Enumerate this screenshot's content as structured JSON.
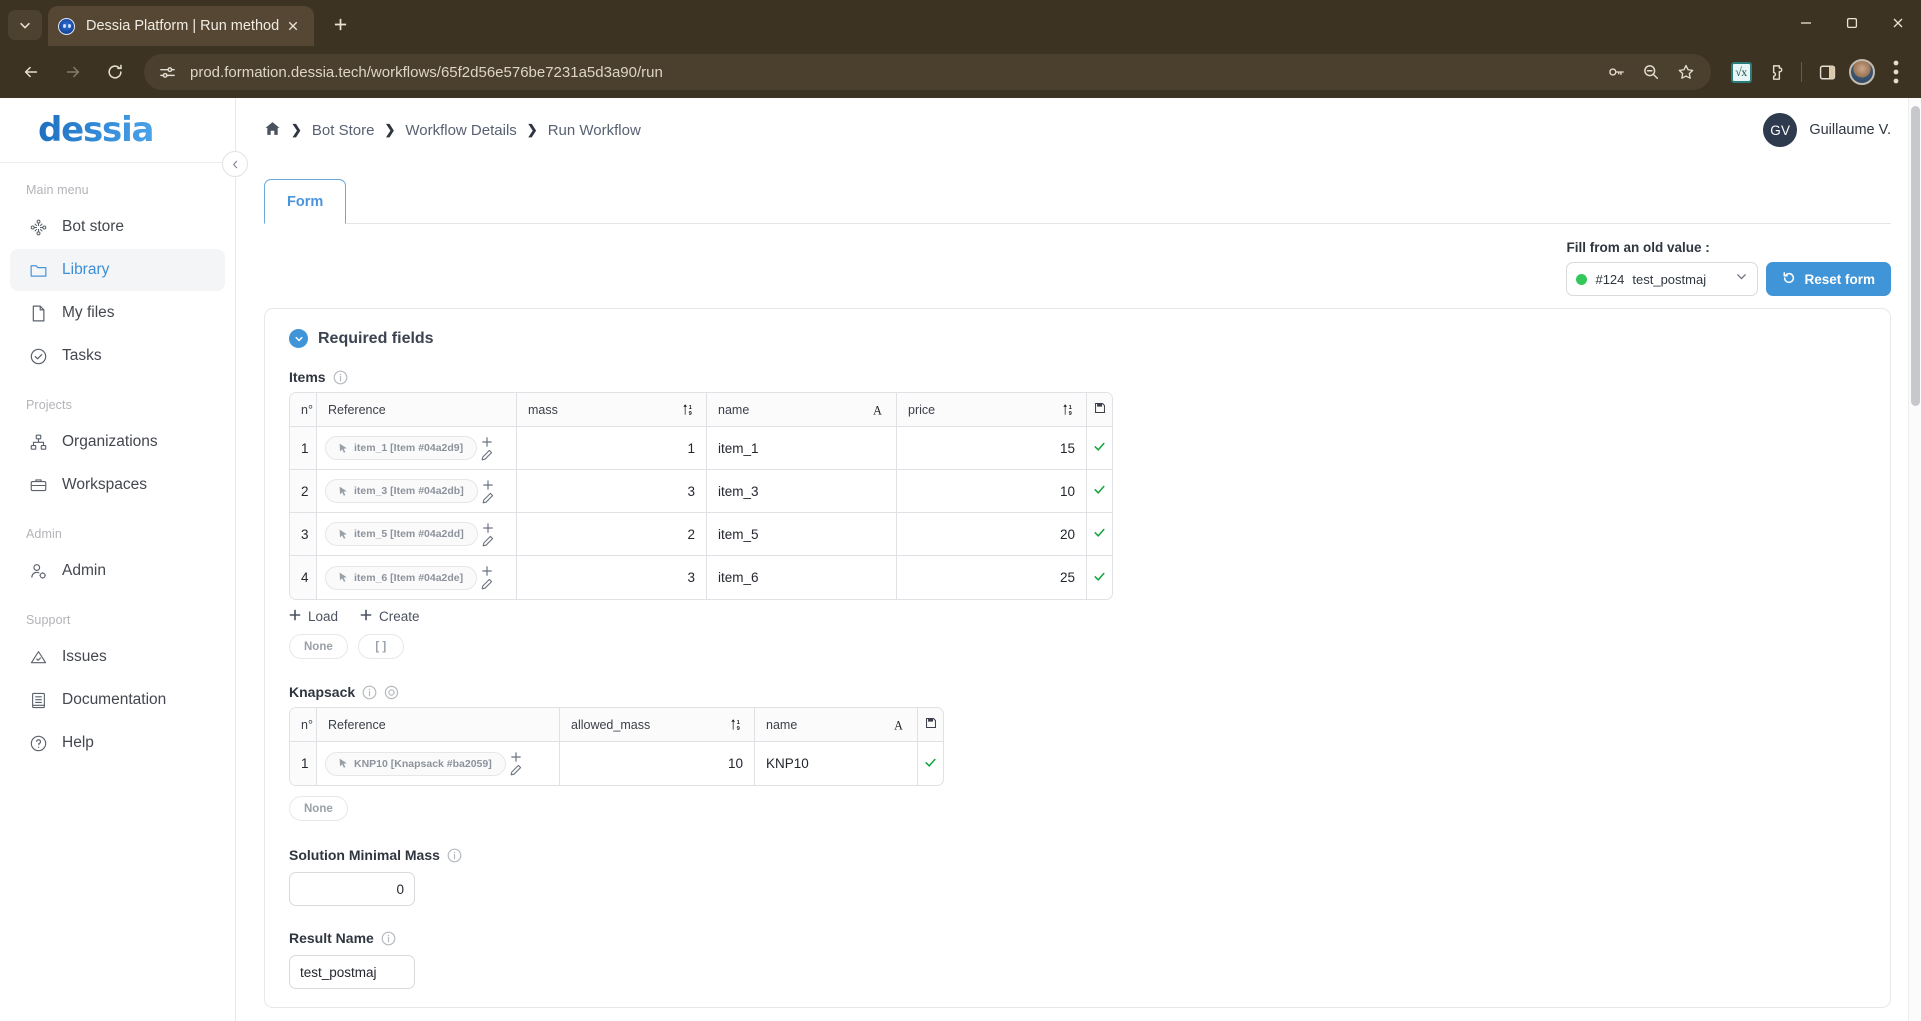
{
  "browser": {
    "tab": {
      "title": "Dessia Platform | Run method",
      "favicon": "dessia-favicon"
    },
    "new_tab_label": "+",
    "url": "prod.formation.dessia.tech/workflows/65f2d56e576be7231a5d3a90/run",
    "toolbar_icons": [
      "back-arrow-icon",
      "forward-arrow-icon",
      "reload-icon",
      "site-settings-icon",
      "password-key-icon",
      "zoom-out-icon",
      "bookmark-star-icon",
      "math-extension-icon",
      "extensions-puzzle-icon",
      "side-panel-icon",
      "profile-avatar-icon",
      "three-dot-menu-icon"
    ],
    "window_controls": [
      "minimize",
      "maximize",
      "close"
    ]
  },
  "sidebar": {
    "logo": "dessia",
    "sections": [
      {
        "title": "Main menu",
        "items": [
          {
            "label": "Bot store",
            "icon": "bot-store-icon",
            "active": false
          },
          {
            "label": "Library",
            "icon": "folder-icon",
            "active": true
          },
          {
            "label": "My files",
            "icon": "file-icon",
            "active": false
          },
          {
            "label": "Tasks",
            "icon": "check-circle-icon",
            "active": false
          }
        ]
      },
      {
        "title": "Projects",
        "items": [
          {
            "label": "Organizations",
            "icon": "org-chart-icon",
            "active": false
          },
          {
            "label": "Workspaces",
            "icon": "briefcase-icon",
            "active": false
          }
        ]
      },
      {
        "title": "Admin",
        "items": [
          {
            "label": "Admin",
            "icon": "user-gear-icon",
            "active": false
          }
        ]
      },
      {
        "title": "Support",
        "items": [
          {
            "label": "Issues",
            "icon": "warning-triangle-icon",
            "active": false
          },
          {
            "label": "Documentation",
            "icon": "book-icon",
            "active": false
          },
          {
            "label": "Help",
            "icon": "question-circle-icon",
            "active": false
          }
        ]
      }
    ]
  },
  "topbar": {
    "breadcrumb": [
      "Bot Store",
      "Workflow Details",
      "Run Workflow"
    ],
    "separator": "›",
    "user": {
      "initials": "GV",
      "name": "Guillaume V."
    }
  },
  "tabs": [
    {
      "label": "Form",
      "active": true
    }
  ],
  "old_value": {
    "label": "Fill from an old value :",
    "status_color": "#34c759",
    "id": "#124",
    "name": "test_postmaj",
    "reset_label": "Reset form"
  },
  "form": {
    "section_title": "Required fields",
    "items": {
      "label": "Items",
      "columns": [
        {
          "key": "num",
          "label": "n°",
          "icon": ""
        },
        {
          "key": "ref",
          "label": "Reference",
          "icon": ""
        },
        {
          "key": "mass",
          "label": "mass",
          "icon": "sort-numeric-icon"
        },
        {
          "key": "name",
          "label": "name",
          "icon": "sort-alpha-icon"
        },
        {
          "key": "price",
          "label": "price",
          "icon": "sort-numeric-icon"
        },
        {
          "key": "lock",
          "label": "",
          "icon": "save-disk-icon"
        }
      ],
      "rows": [
        {
          "num": "1",
          "ref": "item_1 [Item #04a2d9]",
          "mass": "1",
          "name": "item_1",
          "price": "15",
          "status": "valid"
        },
        {
          "num": "2",
          "ref": "item_3 [Item #04a2db]",
          "mass": "3",
          "name": "item_3",
          "price": "10",
          "status": "valid"
        },
        {
          "num": "3",
          "ref": "item_5 [Item #04a2dd]",
          "mass": "2",
          "name": "item_5",
          "price": "20",
          "status": "valid"
        },
        {
          "num": "4",
          "ref": "item_6 [Item #04a2de]",
          "mass": "3",
          "name": "item_6",
          "price": "25",
          "status": "valid"
        }
      ],
      "actions": [
        {
          "label": "Load",
          "icon": "plus-icon"
        },
        {
          "label": "Create",
          "icon": "plus-icon"
        }
      ],
      "chips": [
        "None",
        "[ ]"
      ]
    },
    "knapsack": {
      "label": "Knapsack",
      "columns": [
        {
          "key": "num",
          "label": "n°",
          "icon": ""
        },
        {
          "key": "ref",
          "label": "Reference",
          "icon": ""
        },
        {
          "key": "mass",
          "label": "allowed_mass",
          "icon": "sort-numeric-icon"
        },
        {
          "key": "name",
          "label": "name",
          "icon": "sort-alpha-icon"
        },
        {
          "key": "lock",
          "label": "",
          "icon": "save-disk-icon"
        }
      ],
      "rows": [
        {
          "num": "1",
          "ref": "KNP10 [Knapsack #ba2059]",
          "mass": "10",
          "name": "KNP10",
          "status": "valid"
        }
      ],
      "chips": [
        "None"
      ]
    },
    "solution_minimal_mass": {
      "label": "Solution Minimal Mass",
      "value": "0"
    },
    "result_name": {
      "label": "Result Name",
      "value": "test_postmaj"
    }
  }
}
